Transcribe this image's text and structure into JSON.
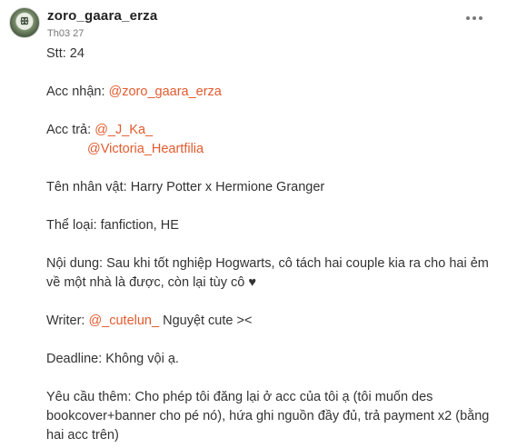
{
  "post": {
    "username": "zoro_gaara_erza",
    "timestamp": "Th03 27",
    "avatar_icon": "user-avatar-icon",
    "more_icon": "more-horizontal-icon"
  },
  "content": {
    "stt": "Stt: 24",
    "acc_nhan_label": "Acc nhận: ",
    "acc_nhan_mention": "@zoro_gaara_erza",
    "acc_tra_label": "Acc trả: ",
    "acc_tra_mention1": "@_J_Ka_",
    "acc_tra_mention2": "@Victoria_Heartfilia",
    "ten_nhan_vat": "Tên nhân vật: Harry Potter x Hermione Granger",
    "the_loai": "Thể loại: fanfiction, HE",
    "noi_dung_line1": "Nội dung: Sau khi tốt nghiệp Hogwarts, cô tách hai couple kia ra cho hai ẻm",
    "noi_dung_line2": "về một nhà là được, còn lại tùy cô ♥",
    "writer_label": "Writer: ",
    "writer_mention": "@_cutelun_",
    "writer_suffix": " Nguyệt cute ><",
    "deadline": "Deadline: Không vội ạ.",
    "yeu_cau_line1": "Yêu cầu thêm: Cho phép tôi đăng lại ở acc của tôi ạ (tôi muốn des",
    "yeu_cau_line2": "bookcover+banner cho pé nó), hứa ghi nguồn đầy đủ, trả payment x2 (bằng",
    "yeu_cau_line3": "hai acc trên)"
  },
  "colors": {
    "mention": "#e35b2e",
    "text": "#333333",
    "timestamp": "#777777"
  }
}
